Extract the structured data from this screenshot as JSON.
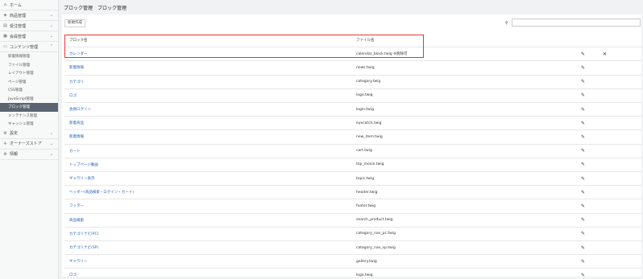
{
  "sidebar": {
    "items": [
      {
        "label": "ホーム",
        "icon": "home-icon",
        "glyph": "⌂",
        "chev": ""
      },
      {
        "label": "商品管理",
        "icon": "tag-icon",
        "glyph": "◈",
        "chev": "⌄"
      },
      {
        "label": "受注管理",
        "icon": "cart-icon",
        "glyph": "▤",
        "chev": "⌄"
      },
      {
        "label": "会員管理",
        "icon": "user-icon",
        "glyph": "▣",
        "chev": "⌄"
      },
      {
        "label": "コンテンツ管理",
        "icon": "file-icon",
        "glyph": "▭",
        "chev": "⌃"
      }
    ],
    "subitems": [
      "新着情報管理",
      "ファイル管理",
      "レイアウト管理",
      "ページ管理",
      "CSS管理",
      "JavaScript管理",
      "ブロック管理",
      "メンテナンス管理",
      "キャッシュ管理"
    ],
    "active_sub": 6,
    "bottom_items": [
      {
        "label": "設定",
        "icon": "gear-icon",
        "glyph": "⚙",
        "chev": "⌄"
      },
      {
        "label": "オーナーズストア",
        "icon": "puzzle-icon",
        "glyph": "✢",
        "chev": "⌄"
      },
      {
        "label": "情報",
        "icon": "gear-icon",
        "glyph": "⚙",
        "chev": "⌄"
      }
    ]
  },
  "header": {
    "title": "ブロック管理　ブロック管理"
  },
  "toolbar": {
    "new_label": "新規作成",
    "search_placeholder": ""
  },
  "table": {
    "header": {
      "name": "ブロック名",
      "file": "ファイル名"
    },
    "rows": [
      {
        "name": "カレンダー",
        "file": "calendar_block.twig ※削除可"
      },
      {
        "name": "新着情報",
        "file": "news.twig"
      },
      {
        "name": "カテゴリ",
        "file": "category.twig"
      },
      {
        "name": "ロゴ",
        "file": "logo.twig"
      },
      {
        "name": "会員ログイン",
        "file": "login.twig"
      },
      {
        "name": "新着商品",
        "file": "eyecatch.twig"
      },
      {
        "name": "新着情報",
        "file": "new_item.twig"
      },
      {
        "name": "カート",
        "file": "cart.twig"
      },
      {
        "name": "トップページ動画",
        "file": "top_movie.twig"
      },
      {
        "name": "ギャラリー表示",
        "file": "topic.twig"
      },
      {
        "name": "ヘッダー(商品検索・ログイン・カート)",
        "file": "header.twig"
      },
      {
        "name": "フッター",
        "file": "footer.twig"
      },
      {
        "name": "商品検索",
        "file": "search_product.twig"
      },
      {
        "name": "カテゴリナビ(PC)",
        "file": "category_nav_pc.twig"
      },
      {
        "name": "カテゴリナビ(SP)",
        "file": "category_nav_sp.twig"
      },
      {
        "name": "ギャラリー",
        "file": "gallery.twig"
      },
      {
        "name": "ロゴ",
        "file": "logo.twig"
      }
    ]
  },
  "colors": {
    "highlight": "#e03a2e",
    "link": "#1e5fb3",
    "active": "#5b6470"
  }
}
